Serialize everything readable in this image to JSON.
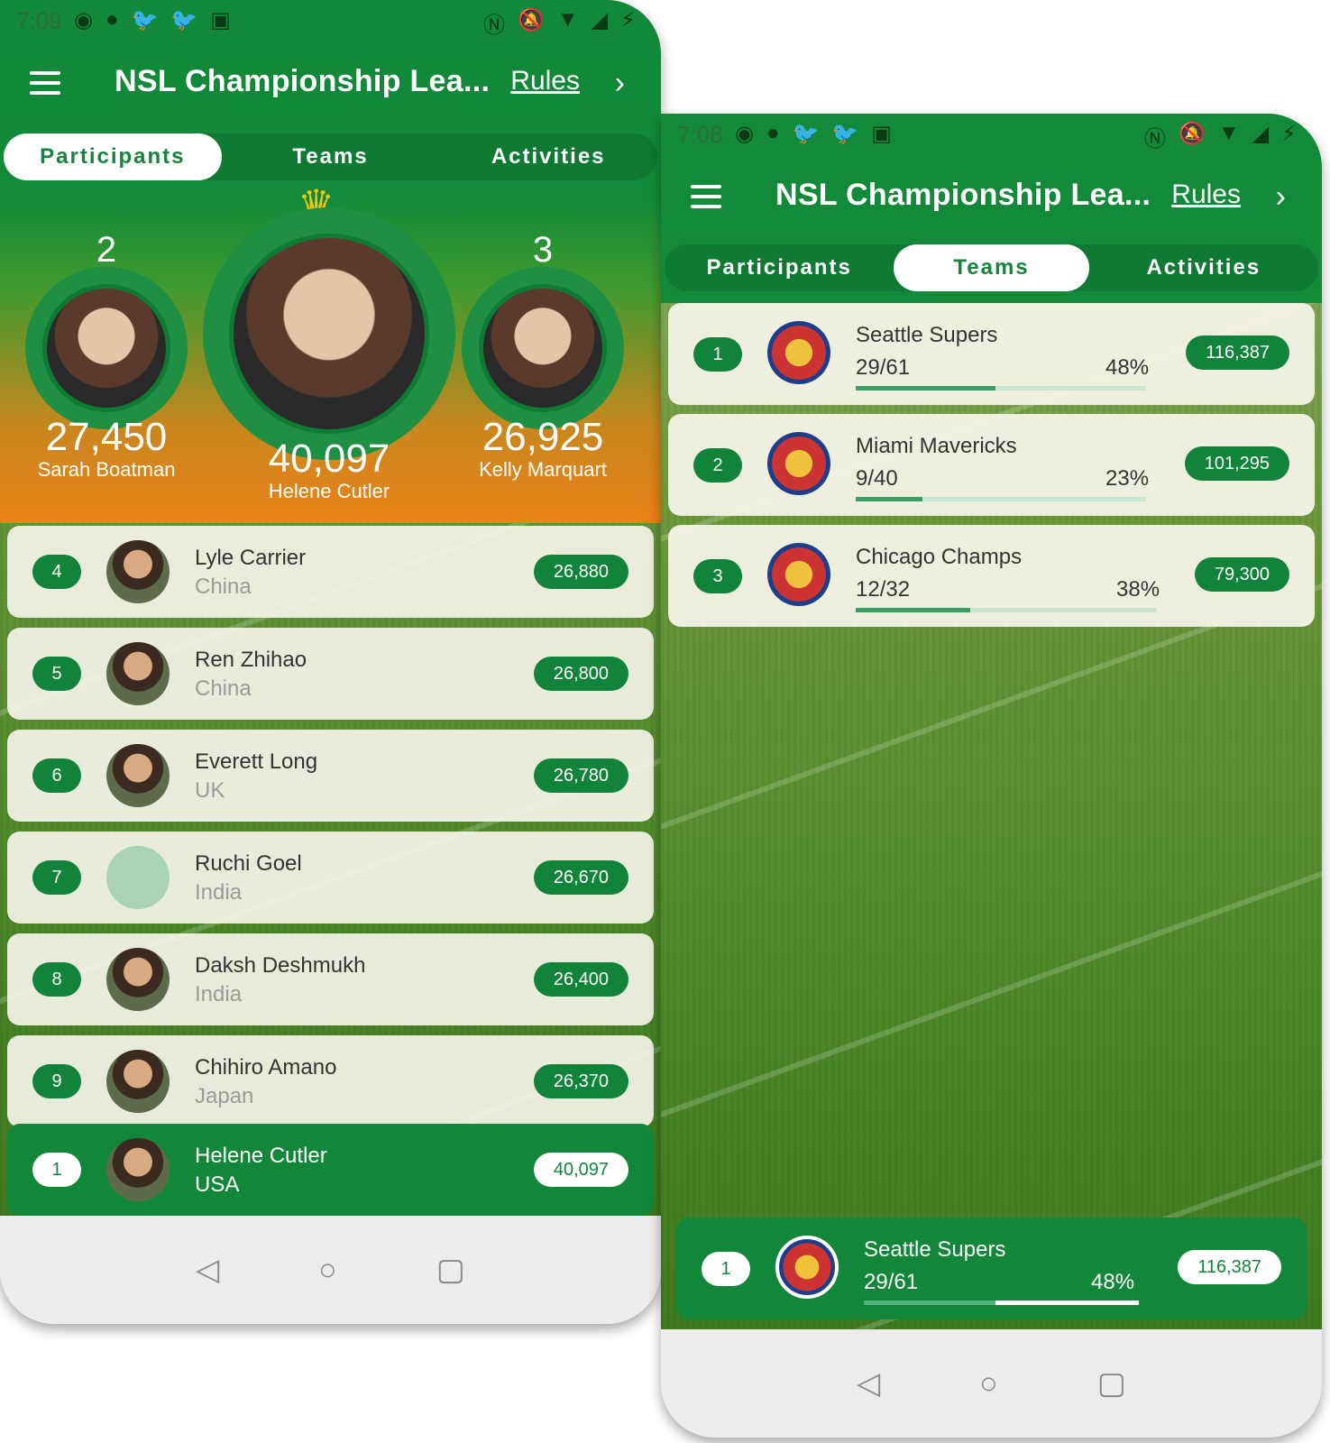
{
  "statusbar": {
    "time_left": "7:09",
    "time_right": "7:08"
  },
  "app": {
    "title": "NSL Championship Lea...",
    "rules_label": "Rules"
  },
  "tabs": [
    "Participants",
    "Teams",
    "Activities"
  ],
  "podium": {
    "first": {
      "rank": "1",
      "score": "40,097",
      "name": "Helene Cutler"
    },
    "second": {
      "rank": "2",
      "score": "27,450",
      "name": "Sarah Boatman"
    },
    "third": {
      "rank": "3",
      "score": "26,925",
      "name": "Kelly Marquart"
    }
  },
  "participants": [
    {
      "rank": "4",
      "name": "Lyle Carrier",
      "country": "China",
      "score": "26,880"
    },
    {
      "rank": "5",
      "name": "Ren Zhihao",
      "country": "China",
      "score": "26,800"
    },
    {
      "rank": "6",
      "name": "Everett Long",
      "country": "UK",
      "score": "26,780"
    },
    {
      "rank": "7",
      "name": "Ruchi Goel",
      "country": "India",
      "score": "26,670"
    },
    {
      "rank": "8",
      "name": "Daksh Deshmukh",
      "country": "India",
      "score": "26,400"
    },
    {
      "rank": "9",
      "name": "Chihiro Amano",
      "country": "Japan",
      "score": "26,370"
    }
  ],
  "my_participant": {
    "rank": "1",
    "name": "Helene Cutler",
    "country": "USA",
    "score": "40,097"
  },
  "teams": [
    {
      "rank": "1",
      "name": "Seattle Supers",
      "fraction": "29/61",
      "percent": "48%",
      "progress": 0.48,
      "score": "116,387"
    },
    {
      "rank": "2",
      "name": "Miami Mavericks",
      "fraction": "9/40",
      "percent": "23%",
      "progress": 0.23,
      "score": "101,295"
    },
    {
      "rank": "3",
      "name": "Chicago Champs",
      "fraction": "12/32",
      "percent": "38%",
      "progress": 0.38,
      "score": "79,300"
    }
  ],
  "my_team": {
    "rank": "1",
    "name": "Seattle Supers",
    "fraction": "29/61",
    "percent": "48%",
    "progress": 0.48,
    "score": "116,387"
  },
  "colors": {
    "primary": "#12873a",
    "accent_orange": "#ea8219",
    "crown": "#f2c514"
  }
}
